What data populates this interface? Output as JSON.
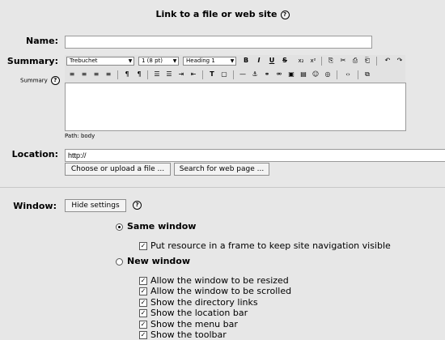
{
  "page_title": "Link to a file or web site",
  "fields": {
    "name_label": "Name:",
    "name_value": "",
    "summary_label": "Summary:",
    "summary_help_label": "Summary",
    "summary_value": "",
    "path_text": "Path: body",
    "location_label": "Location:",
    "location_value": "http://"
  },
  "toolbar": {
    "font_family": "Trebuchet",
    "font_size": "1 (8 pt)",
    "heading": "Heading 1",
    "buttons": [
      "B",
      "I",
      "U",
      "S",
      "x₂",
      "x²",
      "⎘",
      "✂",
      "⎙",
      "⎗",
      "↶",
      "↷",
      "≡",
      "≡",
      "≡",
      "≡",
      "¶",
      "¶",
      "☰",
      "☰",
      "⇥",
      "⇤",
      "T",
      "▢",
      "—",
      "⚓",
      "⚭",
      "⚮",
      "▣",
      "▤",
      "☺",
      "◎",
      "‹›",
      "⧉"
    ]
  },
  "buttons": {
    "choose_file": "Choose or upload a file ...",
    "search_web": "Search for web page ...",
    "hide_settings": "Hide settings"
  },
  "window": {
    "label": "Window:",
    "same_window": "Same window",
    "frame_option": "Put resource in a frame to keep site navigation visible",
    "new_window": "New window",
    "new_window_options": [
      "Allow the window to be resized",
      "Allow the window to be scrolled",
      "Show the directory links",
      "Show the location bar",
      "Show the menu bar",
      "Show the toolbar"
    ]
  }
}
